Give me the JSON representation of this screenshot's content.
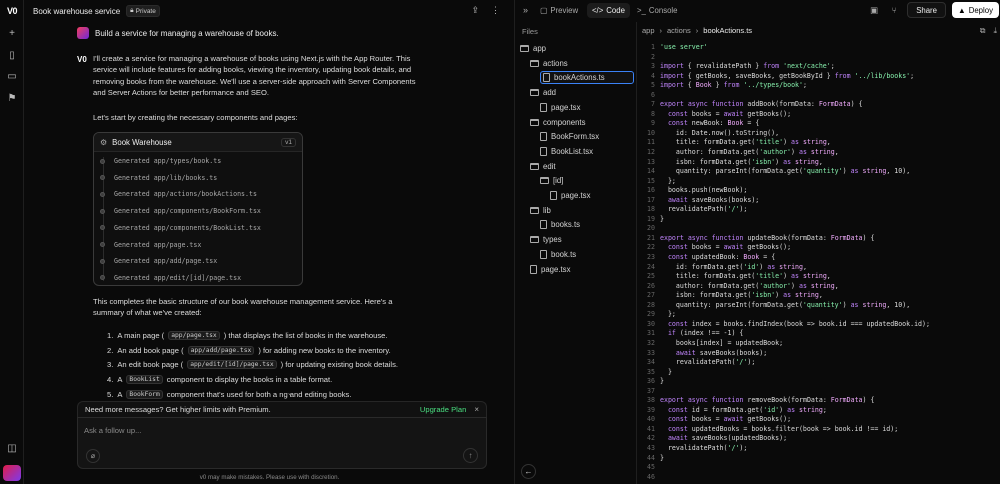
{
  "chat": {
    "title": "Book warehouse service",
    "private_label": "Private",
    "user_message": "Build a service for managing a warehouse of books.",
    "v0_label": "V0",
    "intro": "I'll create a service for managing a warehouse of books using Next.js with the App Router. This service will include features for adding books, viewing the inventory, updating book details, and removing books from the warehouse. We'll use a server-side approach with Server Components and Server Actions for better performance and SEO.",
    "lead": "Let's start by creating the necessary components and pages:",
    "block": {
      "title": "Book Warehouse",
      "version": "v1",
      "generated": [
        "Generated app/types/book.ts",
        "Generated app/lib/books.ts",
        "Generated app/actions/bookActions.ts",
        "Generated app/components/BookForm.tsx",
        "Generated app/components/BookList.tsx",
        "Generated app/page.tsx",
        "Generated app/add/page.tsx",
        "Generated app/edit/[id]/page.tsx"
      ]
    },
    "summary": "This completes the basic structure of our book warehouse management service. Here's a summary of what we've created:",
    "steps": [
      {
        "num": "1.",
        "pre": "A main page (",
        "code": "app/page.tsx",
        "post": ") that displays the list of books in the warehouse."
      },
      {
        "num": "2.",
        "pre": "An add book page (",
        "code": "app/add/page.tsx",
        "post": ") for adding new books to the inventory."
      },
      {
        "num": "3.",
        "pre": "An edit book page (",
        "code": "app/edit/[id]/page.tsx",
        "post": ") for updating existing book details."
      },
      {
        "num": "4.",
        "pre": "A ",
        "code": "BookList",
        "post": " component to display the books in a table format."
      },
      {
        "num": "5.",
        "pre": "A ",
        "code": "BookForm",
        "post": " component that's used for both a   ng and editing books."
      }
    ],
    "premium_message": "Need more messages? Get higher limits with Premium.",
    "upgrade_label": "Upgrade Plan",
    "input_placeholder": "Ask a follow up...",
    "disclaimer": "v0 may make mistakes. Please use with discretion."
  },
  "right": {
    "tabs": {
      "preview": "Preview",
      "code": "Code",
      "console": "Console"
    },
    "share_label": "Share",
    "deploy_label": "Deploy",
    "files_label": "Files",
    "tree": [
      {
        "label": "app",
        "type": "folder",
        "depth": 0
      },
      {
        "label": "actions",
        "type": "folder",
        "depth": 1
      },
      {
        "label": "bookActions.ts",
        "type": "file",
        "depth": 2,
        "selected": true
      },
      {
        "label": "add",
        "type": "folder",
        "depth": 1
      },
      {
        "label": "page.tsx",
        "type": "file",
        "depth": 2
      },
      {
        "label": "components",
        "type": "folder",
        "depth": 1
      },
      {
        "label": "BookForm.tsx",
        "type": "file",
        "depth": 2
      },
      {
        "label": "BookList.tsx",
        "type": "file",
        "depth": 2
      },
      {
        "label": "edit",
        "type": "folder",
        "depth": 1
      },
      {
        "label": "[id]",
        "type": "folder",
        "depth": 2
      },
      {
        "label": "page.tsx",
        "type": "file",
        "depth": 3
      },
      {
        "label": "lib",
        "type": "folder",
        "depth": 1
      },
      {
        "label": "books.ts",
        "type": "file",
        "depth": 2
      },
      {
        "label": "types",
        "type": "folder",
        "depth": 1
      },
      {
        "label": "book.ts",
        "type": "file",
        "depth": 2
      },
      {
        "label": "page.tsx",
        "type": "file",
        "depth": 1
      }
    ],
    "breadcrumb": [
      "app",
      "actions",
      "bookActions.ts"
    ],
    "code_lines": [
      "'use server'",
      "",
      "import { revalidatePath } from 'next/cache';",
      "import { getBooks, saveBooks, getBookById } from '../lib/books';",
      "import { Book } from '../types/book';",
      "",
      "export async function addBook(formData: FormData) {",
      "  const books = await getBooks();",
      "  const newBook: Book = {",
      "    id: Date.now().toString(),",
      "    title: formData.get('title') as string,",
      "    author: formData.get('author') as string,",
      "    isbn: formData.get('isbn') as string,",
      "    quantity: parseInt(formData.get('quantity') as string, 10),",
      "  };",
      "  books.push(newBook);",
      "  await saveBooks(books);",
      "  revalidatePath('/');",
      "}",
      "",
      "export async function updateBook(formData: FormData) {",
      "  const books = await getBooks();",
      "  const updatedBook: Book = {",
      "    id: formData.get('id') as string,",
      "    title: formData.get('title') as string,",
      "    author: formData.get('author') as string,",
      "    isbn: formData.get('isbn') as string,",
      "    quantity: parseInt(formData.get('quantity') as string, 10),",
      "  };",
      "  const index = books.findIndex(book => book.id === updatedBook.id);",
      "  if (index !== -1) {",
      "    books[index] = updatedBook;",
      "    await saveBooks(books);",
      "    revalidatePath('/');",
      "  }",
      "}",
      "",
      "export async function removeBook(formData: FormData) {",
      "  const id = formData.get('id') as string;",
      "  const books = await getBooks();",
      "  const updatedBooks = books.filter(book => book.id !== id);",
      "  await saveBooks(updatedBooks);",
      "  revalidatePath('/');",
      "}",
      "",
      ""
    ]
  }
}
